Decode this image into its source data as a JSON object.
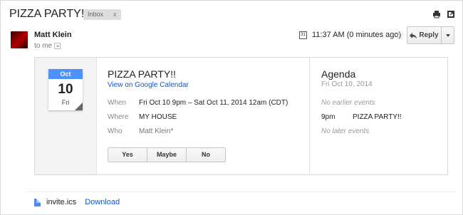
{
  "email": {
    "subject": "PIZZA PARTY!!",
    "label": "Inbox",
    "label_remove": "x",
    "sender": "Matt Klein",
    "to": "to me",
    "calendar_icon_text": "31",
    "timestamp": "11:37 AM (0 minutes ago)",
    "reply_label": "Reply"
  },
  "invite": {
    "month": "Oct",
    "day": "10",
    "weekday": "Fri",
    "title": "PIZZA PARTY!!",
    "calendar_link": "View on Google Calendar",
    "when_label": "When",
    "when_value": "Fri Oct 10 9pm – Sat Oct 11, 2014 12am (CDT)",
    "where_label": "Where",
    "where_value": "MY HOUSE",
    "who_label": "Who",
    "who_value": "Matt Klein*",
    "rsvp": {
      "yes": "Yes",
      "maybe": "Maybe",
      "no": "No"
    }
  },
  "agenda": {
    "title": "Agenda",
    "date": "Fri Oct 10, 2014",
    "no_earlier": "No earlier events",
    "event_time": "9pm",
    "event_title": "PIZZA PARTY!!",
    "no_later": "No later events"
  },
  "attachment": {
    "filename": "invite.ics",
    "download_label": "Download"
  }
}
